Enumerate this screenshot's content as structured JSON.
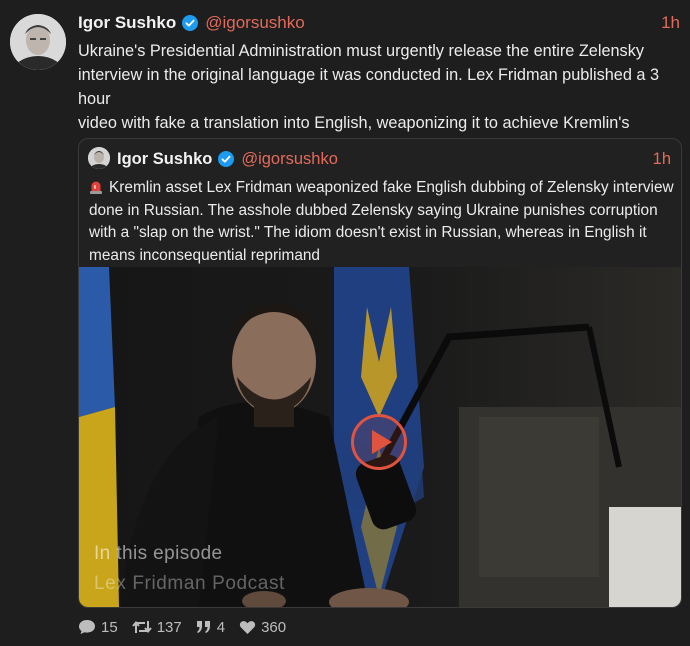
{
  "author": {
    "name": "Igor Sushko",
    "handle": "@igorsushko",
    "time": "1h",
    "avatar_icon": "profile-photo"
  },
  "tweet": {
    "text": "Ukraine's Presidential Administration must urgently release the entire Zelensky\ninterview in the original language it was conducted in. Lex Fridman published a 3 hour\nvideo with fake a translation into English, weaponizing it to achieve Kremlin's\ndisinformation objectives."
  },
  "quote": {
    "name": "Igor Sushko",
    "handle": "@igorsushko",
    "time": "1h",
    "text": "Kremlin asset Lex Fridman weaponized fake English dubbing of Zelensky interview done in Russian. The asshole dubbed Zelensky saying Ukraine punishes corruption with a \"slap on the wrist.\" The idiom doesn't exist in Russian, whereas in English it means inconsequential reprimand",
    "leading_icon": "siren-icon",
    "video": {
      "overlay_line1": "In this episode",
      "overlay_line2": "Lex Fridman Podcast",
      "play_icon": "play-icon"
    }
  },
  "actions": {
    "replies": "15",
    "retweets": "137",
    "quotes": "4",
    "likes": "360"
  },
  "colors": {
    "accent": "#e36a5a",
    "verified": "#1d9bf0",
    "background": "#1e1e1e",
    "play": "#e0533f"
  }
}
